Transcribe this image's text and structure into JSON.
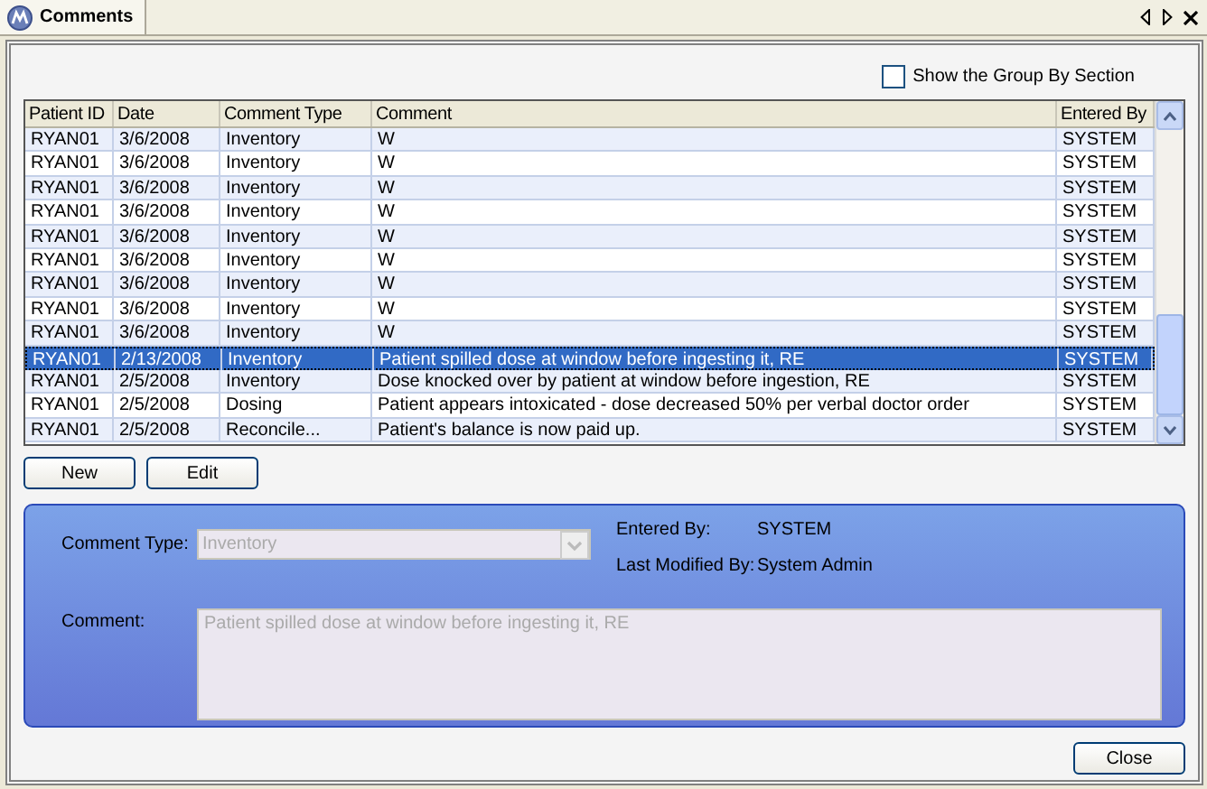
{
  "tab": {
    "title": "Comments",
    "selected": true
  },
  "group_by": {
    "label": "Show the Group By Section",
    "checked": false
  },
  "table": {
    "columns": [
      "Patient ID",
      "Date",
      "Comment Type",
      "Comment",
      "Entered By"
    ],
    "rows": [
      {
        "cells": [
          "RYAN01",
          "3/6/2008",
          "Inventory",
          "W",
          "SYSTEM"
        ],
        "selected": false
      },
      {
        "cells": [
          "RYAN01",
          "3/6/2008",
          "Inventory",
          "W",
          "SYSTEM"
        ],
        "selected": false
      },
      {
        "cells": [
          "RYAN01",
          "3/6/2008",
          "Inventory",
          "W",
          "SYSTEM"
        ],
        "selected": false
      },
      {
        "cells": [
          "RYAN01",
          "3/6/2008",
          "Inventory",
          "W",
          "SYSTEM"
        ],
        "selected": false
      },
      {
        "cells": [
          "RYAN01",
          "3/6/2008",
          "Inventory",
          "W",
          "SYSTEM"
        ],
        "selected": false
      },
      {
        "cells": [
          "RYAN01",
          "3/6/2008",
          "Inventory",
          "W",
          "SYSTEM"
        ],
        "selected": false
      },
      {
        "cells": [
          "RYAN01",
          "3/6/2008",
          "Inventory",
          "W",
          "SYSTEM"
        ],
        "selected": false
      },
      {
        "cells": [
          "RYAN01",
          "3/6/2008",
          "Inventory",
          "W",
          "SYSTEM"
        ],
        "selected": false
      },
      {
        "cells": [
          "RYAN01",
          "3/6/2008",
          "Inventory",
          "W",
          "SYSTEM"
        ],
        "selected": false
      },
      {
        "cells": [
          "RYAN01",
          "2/13/2008",
          "Inventory",
          "Patient spilled dose at window before ingesting it, RE",
          "SYSTEM"
        ],
        "selected": true
      },
      {
        "cells": [
          "RYAN01",
          "2/5/2008",
          "Inventory",
          "Dose knocked over by patient at window before ingestion, RE",
          "SYSTEM"
        ],
        "selected": false
      },
      {
        "cells": [
          "RYAN01",
          "2/5/2008",
          "Dosing",
          "Patient appears intoxicated - dose decreased 50% per verbal doctor order",
          "SYSTEM"
        ],
        "selected": false
      },
      {
        "cells": [
          "RYAN01",
          "2/5/2008",
          "Reconcile...",
          "Patient's balance is now paid up.",
          "SYSTEM"
        ],
        "selected": false
      }
    ]
  },
  "actions": [
    "New",
    "Edit"
  ],
  "detail": {
    "comment_type": {
      "label": "Comment Type:",
      "value": "Inventory",
      "disabled": true
    },
    "entered_by": {
      "label": "Entered By:",
      "value": "SYSTEM"
    },
    "last_modified_by": {
      "label": "Last Modified By:",
      "value": "System Admin"
    },
    "comment": {
      "label": "Comment:",
      "value": "Patient spilled dose at window before ingesting it, RE",
      "disabled": true
    }
  },
  "close_button": "Close"
}
